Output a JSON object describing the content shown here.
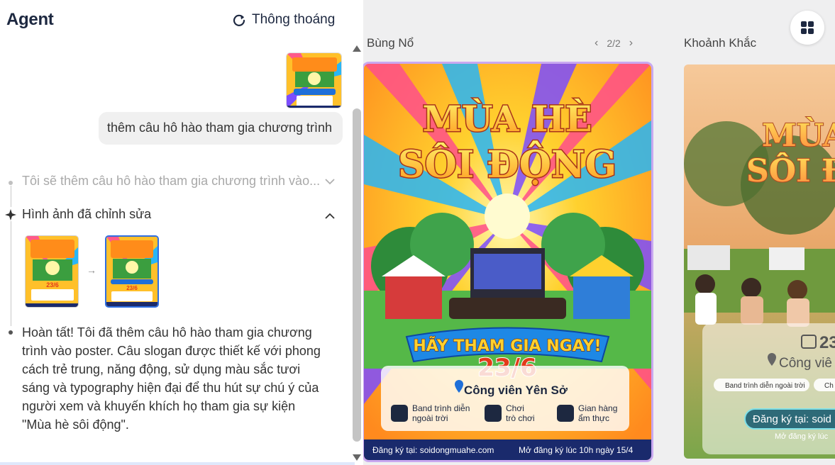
{
  "agent": {
    "title": "Agent",
    "new_chat_label": "Thông thoáng",
    "user_message": "thêm câu hô hào tham gia chương trình",
    "step1_text": "Tôi sẽ thêm câu hô hào tham gia chương trình vào...",
    "step2_text": "Hình ảnh đã chỉnh sửa",
    "final_message": "Hoàn tất! Tôi đã thêm câu hô hào tham gia chương trình vào poster. Câu slogan được thiết kế với phong cách trẻ trung, năng động, sử dụng màu sắc tươi sáng và typography hiện đại để thu hút sự chú ý của người xem và khuyến khích họ tham gia sự kiện \"Mùa hè sôi động\"."
  },
  "canvas": {
    "card1_label": "Bùng Nổ",
    "card2_label": "Khoảnh Khắc",
    "pager": "2/2",
    "pager_prev": "‹",
    "pager_next": "›"
  },
  "poster1": {
    "title_line1": "MÙA HÈ",
    "title_line2": "SÔI ĐỘNG",
    "banner": "HÃY THAM GIA NGAY!",
    "date": "23/6",
    "location": "Công viên Yên Sở",
    "feature1": "Band trình diễn ngoài trời",
    "feature1_a": "Band trình diễn",
    "feature1_b": "ngoài trời",
    "feature2_a": "Chơi",
    "feature2_b": "trò chơi",
    "feature3_a": "Gian hàng",
    "feature3_b": "ẩm thực",
    "register": "Đăng ký tại: soidongmuahe.com",
    "open_reg": "Mở đăng ký lúc 10h ngày 15/4"
  },
  "poster2": {
    "title_line1": "MÙA",
    "title_line2": "SÔI Đ",
    "date": "23",
    "location": "Công viê",
    "feature1": "Band trình diễn ngoài trời",
    "feature2": "Ch",
    "register": "Đăng ký tại: soid",
    "open_reg": "Mở đăng ký lúc"
  },
  "colors": {
    "accent_blue": "#2f6ee0",
    "selected_border": "#c9a8f0",
    "title_navy": "#1d2840"
  },
  "icons": [
    "refresh-icon",
    "sparkle-icon",
    "chevron-down-icon",
    "chevron-up-icon",
    "grid-icon",
    "arrow-right-icon"
  ]
}
